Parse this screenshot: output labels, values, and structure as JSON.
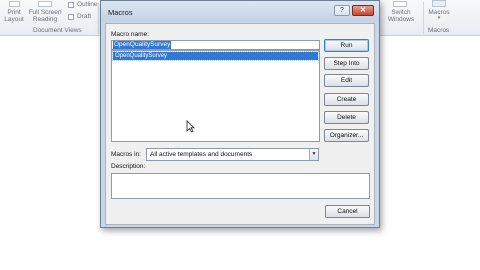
{
  "ribbon": {
    "print_layout": "Print\nLayout",
    "full_screen_reading": "Full Screen\nReading",
    "outline": "Outline",
    "draft": "Draft",
    "document_views": "Document Views",
    "switch_windows": "Switch\nWindows",
    "macros_button": "Macros",
    "macros_group": "Macros"
  },
  "dialog": {
    "title": "Macros",
    "help_glyph": "?",
    "close_glyph": "✕",
    "macro_name_label": "Macro name:",
    "macro_name_value": "OpenQualitySurvey",
    "macro_list": [
      "OpenQualitySurvey"
    ],
    "buttons": {
      "run": "Run",
      "step_into": "Step Into",
      "edit": "Edit",
      "create": "Create",
      "delete": "Delete",
      "organizer": "Organizer...",
      "cancel": "Cancel"
    },
    "macros_in_label": "Macros in:",
    "macros_in_value": "All active templates and documents",
    "description_label": "Description:"
  }
}
